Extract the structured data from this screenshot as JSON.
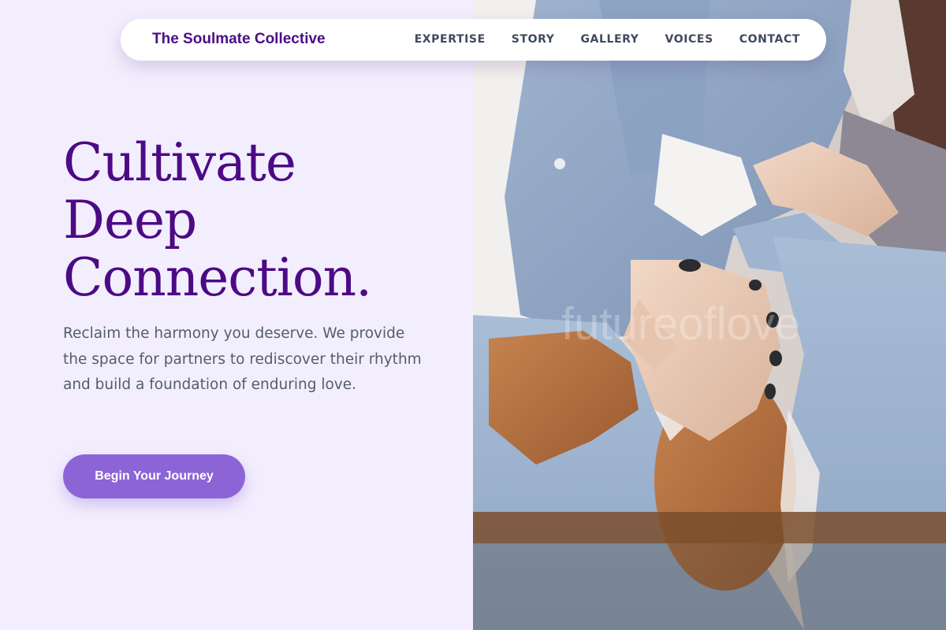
{
  "brand": {
    "name": "The Soulmate Collective"
  },
  "nav": {
    "items": [
      {
        "label": "EXPERTISE"
      },
      {
        "label": "STORY"
      },
      {
        "label": "GALLERY"
      },
      {
        "label": "VOICES"
      },
      {
        "label": "CONTACT"
      }
    ]
  },
  "hero": {
    "headline_lines": [
      "Cultivate",
      "Deep",
      "Connection."
    ],
    "lead": "Reclaim the harmony you deserve. We provide the space for partners to rediscover their rhythm and build a foundation of enduring love.",
    "cta_label": "Begin Your Journey",
    "image_watermark": "futureoflove"
  },
  "colors": {
    "background": "#f3eefe",
    "brand": "#4b0e86",
    "headline": "#4c0a85",
    "body_text": "#545c6c",
    "nav_text": "#3f4a5c",
    "cta": "#8d64d6"
  },
  "icons": {
    "photo": "couple-holding-hands-photo"
  }
}
